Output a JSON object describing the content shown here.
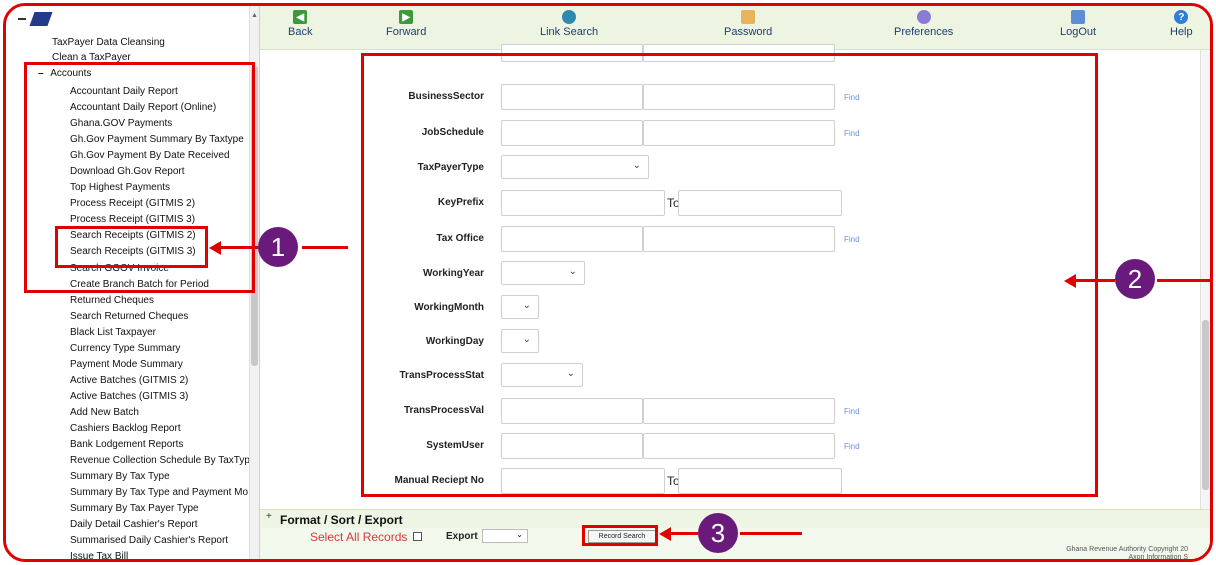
{
  "toolbar": {
    "back": "Back",
    "forward": "Forward",
    "link_search": "Link Search",
    "password": "Password",
    "preferences": "Preferences",
    "logout": "LogOut",
    "help": "Help"
  },
  "sidebar": {
    "top_items": [
      "TaxPayer Data Cleansing",
      "Clean a TaxPayer"
    ],
    "accounts_label": "Accounts",
    "items": [
      "Accountant Daily Report",
      "Accountant Daily Report (Online)",
      "Ghana.GOV Payments",
      "Gh.Gov Payment Summary By Taxtype",
      "Gh.Gov Payment By Date Received",
      "Download Gh.Gov Report",
      "Top Highest Payments",
      "Process Receipt (GITMIS 2)",
      "Process Receipt (GITMIS 3)",
      "Search Receipts (GITMIS 2)",
      "Search Receipts (GITMIS 3)",
      "Search GGOV Invoice",
      "Create Branch Batch for Period",
      "Returned Cheques",
      "Search Returned Cheques",
      "Black List Taxpayer",
      "Currency Type Summary",
      "Payment Mode Summary",
      "Active Batches (GITMIS 2)",
      "Active Batches (GITMIS 3)",
      "Add New Batch",
      "Cashiers Backlog Report",
      "Bank Lodgement Reports",
      "Revenue Collection Schedule By TaxTyp",
      "Summary By Tax Type",
      "Summary By Tax Type and Payment Mo",
      "Summary By Tax Payer Type",
      "Daily Detail Cashier's Report",
      "Summarised Daily Cashier's Report",
      "Issue Tax Bill"
    ]
  },
  "form": {
    "fields": {
      "business_sector": "BusinessSector",
      "job_schedule": "JobSchedule",
      "taxpayer_type": "TaxPayerType",
      "key_prefix": "KeyPrefix",
      "tax_office": "Tax Office",
      "working_year": "WorkingYear",
      "working_month": "WorkingMonth",
      "working_day": "WorkingDay",
      "trans_process_stat": "TransProcessStat",
      "trans_process_val": "TransProcessVal",
      "system_user": "SystemUser",
      "manual_receipt_no": "Manual Reciept No"
    },
    "find_label": "Find",
    "to_label": "To"
  },
  "bottom": {
    "format_title": "Format / Sort / Export",
    "select_all": "Select All Records",
    "export_label": "Export",
    "record_search": "Record Search",
    "copyright_line1": "Ghana Revenue Authority Copyright 20",
    "copyright_line2": "Axon Information S"
  },
  "annotations": {
    "one": "1",
    "two": "2",
    "three": "3"
  },
  "colors": {
    "annotation": "#e00000",
    "badge": "#6a1a7a",
    "toolbar_bg": "#edf5e2"
  }
}
